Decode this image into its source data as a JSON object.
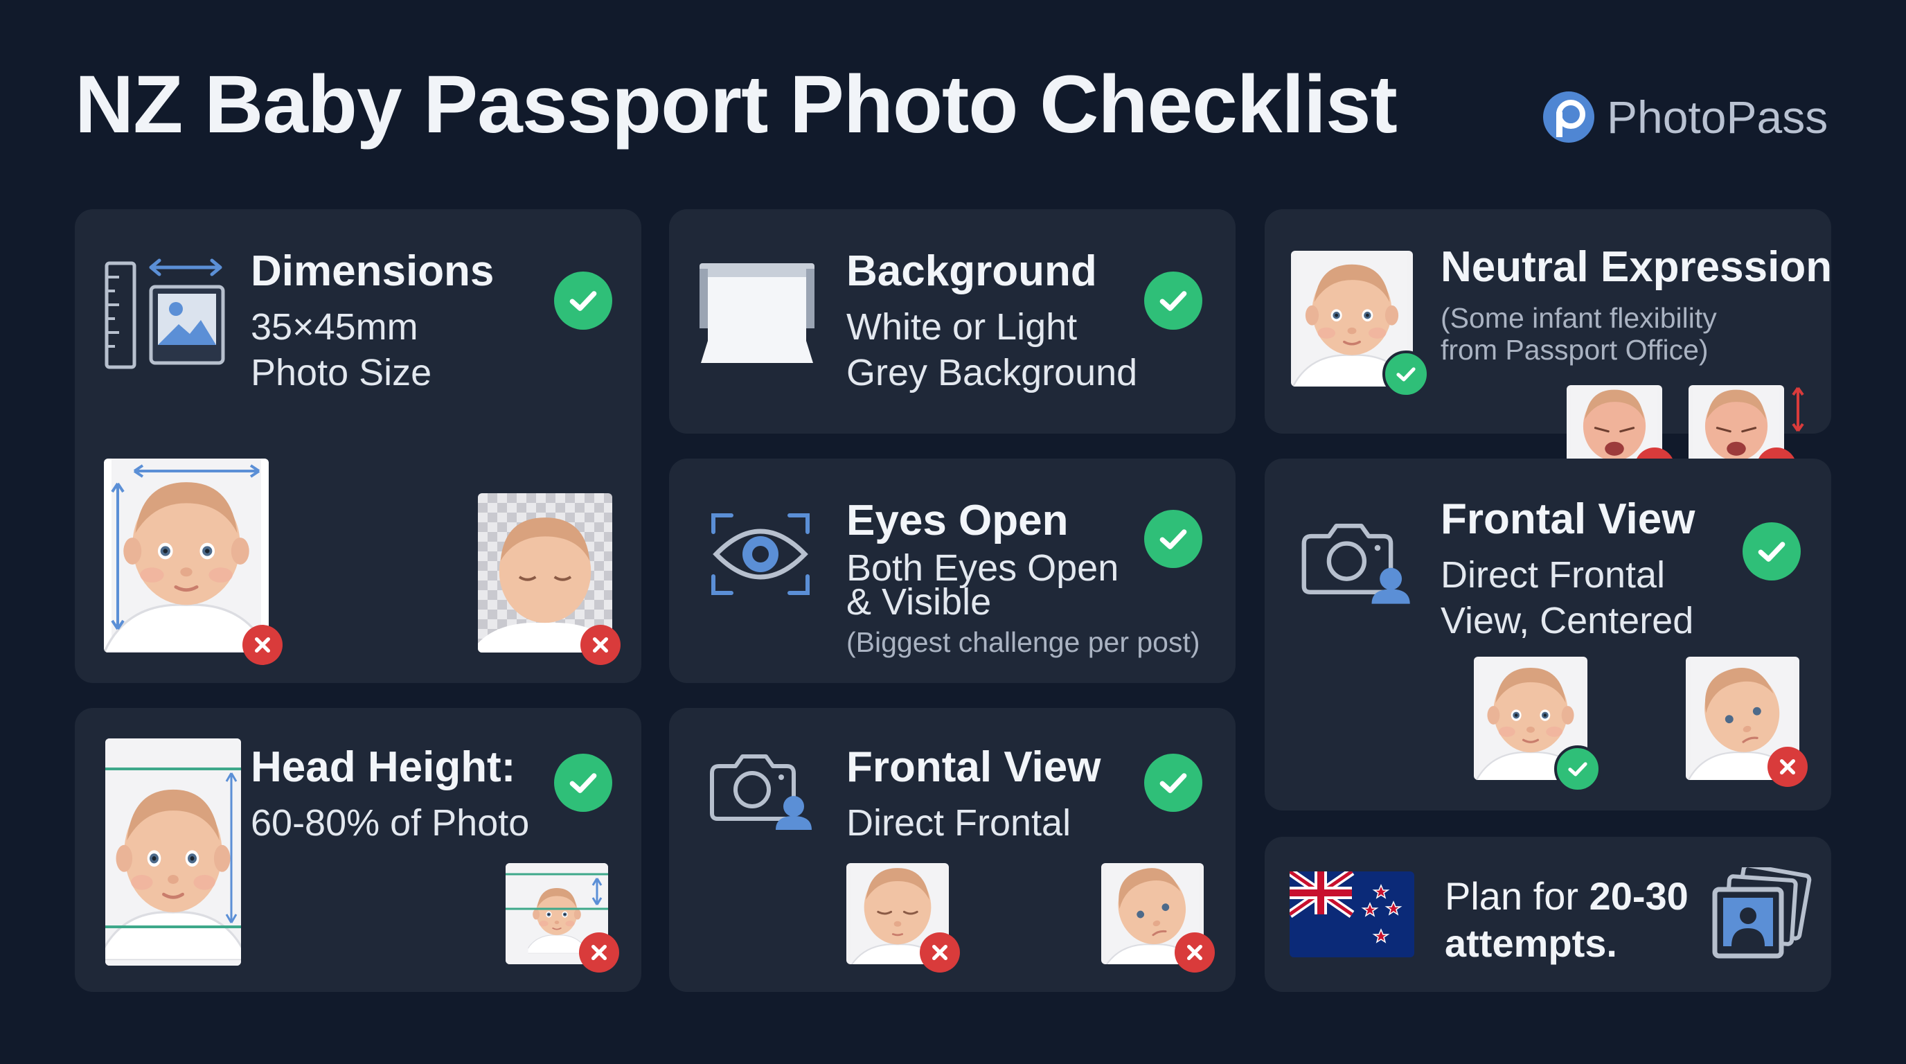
{
  "title": "NZ Baby Passport Photo Checklist",
  "brand": {
    "name": "PhotoPass",
    "icon": "photopass-logo-icon"
  },
  "colors": {
    "background": "#111a2b",
    "card": "#1f2838",
    "pass": "#2fbf78",
    "fail": "#d93b3b",
    "accent": "#5b8fd6"
  },
  "cards": {
    "dimensions": {
      "heading": "Dimensions",
      "line1": "35×45mm",
      "line2": "Photo Size"
    },
    "background": {
      "heading": "Background",
      "line1": "White or Light",
      "line2": "Grey Background"
    },
    "neutral": {
      "heading": "Neutral Expression",
      "note1": "(Some infant flexibility",
      "note2": "from Passport Office)"
    },
    "eyes": {
      "heading": "Eyes Open",
      "line1": "Both Eyes Open",
      "line2": "& Visible",
      "note": "(Biggest challenge per post)"
    },
    "frontal_right": {
      "heading": "Frontal View",
      "line1": "Direct Frontal",
      "line2": "View, Centered"
    },
    "head": {
      "heading": "Head Height:",
      "line1": "60-80% of Photo"
    },
    "frontal_mid": {
      "heading": "Frontal View",
      "line1": "Direct Frontal"
    },
    "attempts": {
      "prefix": "Plan for ",
      "bold1": "20-30",
      "bold2": "attempts."
    }
  }
}
